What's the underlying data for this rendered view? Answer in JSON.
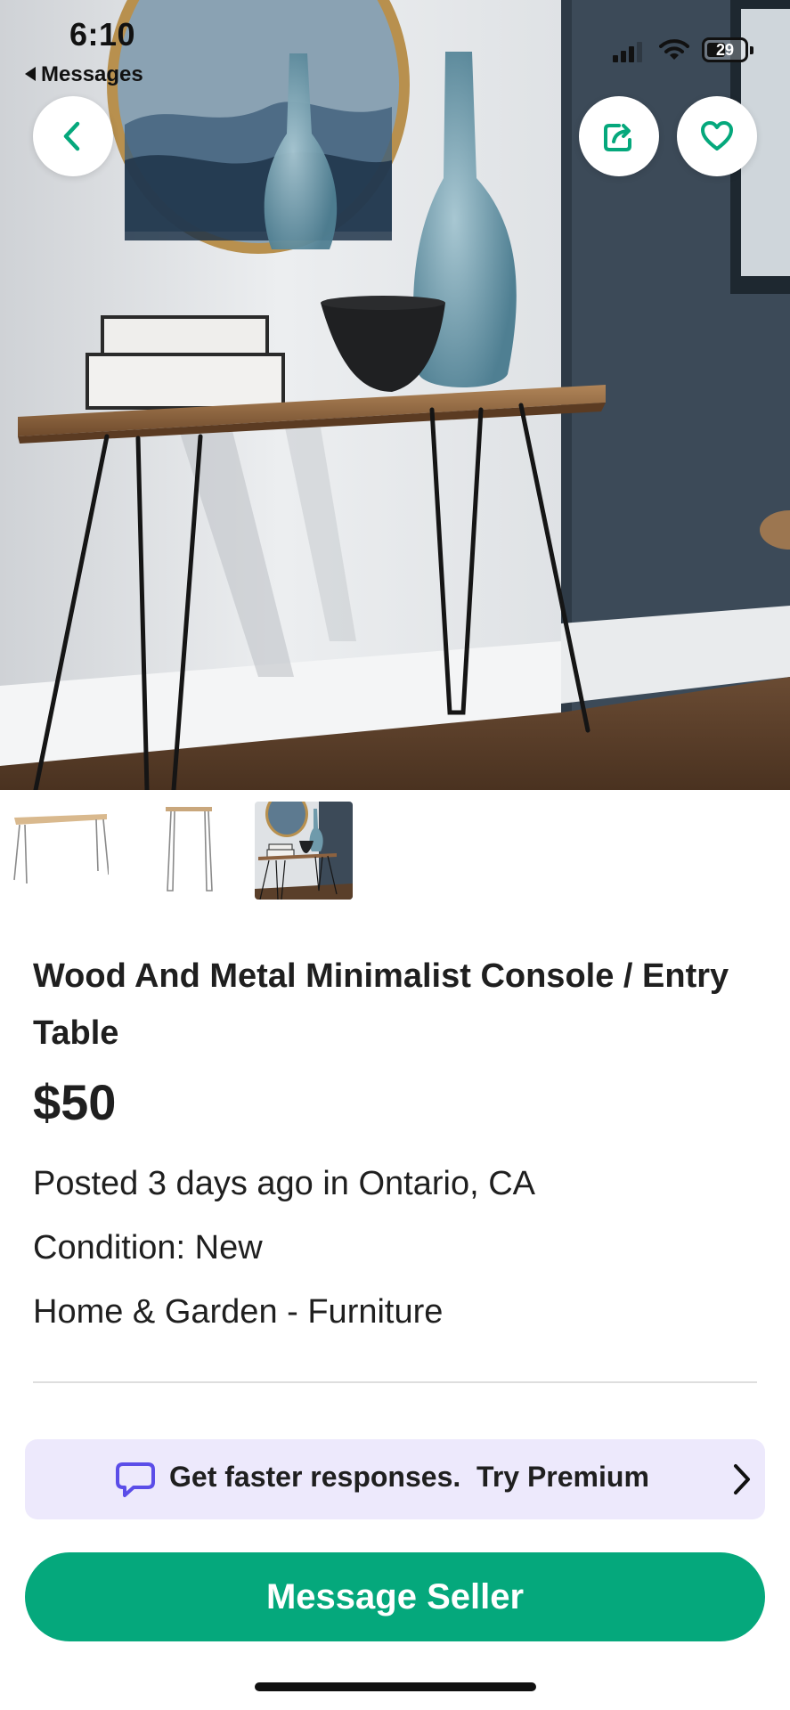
{
  "status_bar": {
    "time": "6:10",
    "back_label": "Messages",
    "battery": "29"
  },
  "nav": {
    "back_icon": "chevron-left-icon",
    "share_icon": "share-icon",
    "favorite_icon": "heart-icon"
  },
  "colors": {
    "brand_green": "#05a87c",
    "premium_bg": "#ede9fc",
    "premium_icon": "#5b4de8"
  },
  "gallery": {
    "image_count": 3,
    "selected_index": 3
  },
  "listing": {
    "title": "Wood And Metal Minimalist Console / Entry Table",
    "price": "$50",
    "posted": "Posted 3 days ago in Ontario, CA",
    "condition": "Condition: New",
    "category": "Home & Garden - Furniture"
  },
  "premium_banner": {
    "icon": "chat-bubble-icon",
    "text": "Get faster responses.  Try Premium"
  },
  "actions": {
    "message_seller": "Message Seller"
  }
}
